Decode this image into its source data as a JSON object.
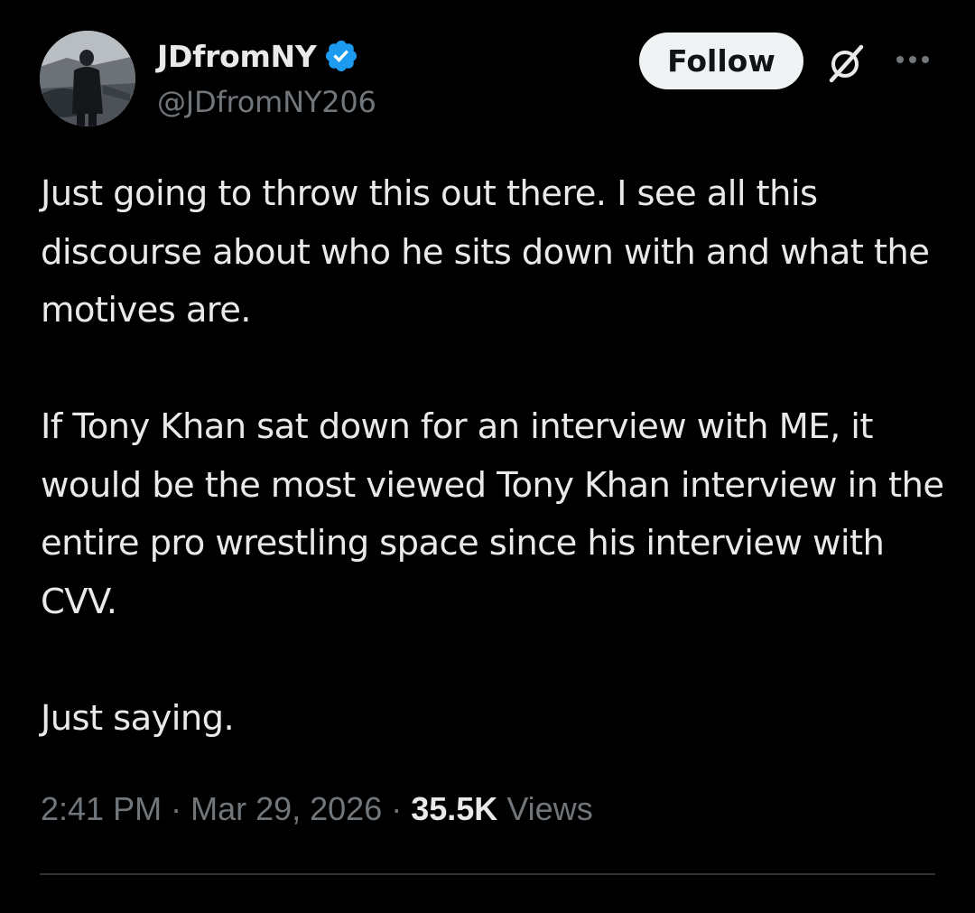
{
  "author": {
    "display_name": "JDfromNY",
    "handle": "@JDfromNY206",
    "verified_icon": "verified-badge-icon",
    "verified_color": "#1d9bf0"
  },
  "actions": {
    "follow_label": "Follow",
    "grok_icon": "grok-icon",
    "more_icon": "more-options-icon"
  },
  "tweet": {
    "text": "Just going to throw this out there. I see all this discourse about who he sits down with and what the motives are.\n\nIf Tony Khan sat down for an interview with ME, it would be the most viewed Tony Khan interview in the entire pro wrestling space since his interview with CVV.\n\nJust saying.",
    "time": "2:41 PM",
    "date": "Mar 29, 2026",
    "view_count": "35.5K",
    "views_label": "Views"
  },
  "colors": {
    "background": "#000000",
    "text": "#e7e9ea",
    "secondary_text": "#71767b",
    "follow_button_bg": "#eff3f4",
    "divider": "#2f3336"
  }
}
